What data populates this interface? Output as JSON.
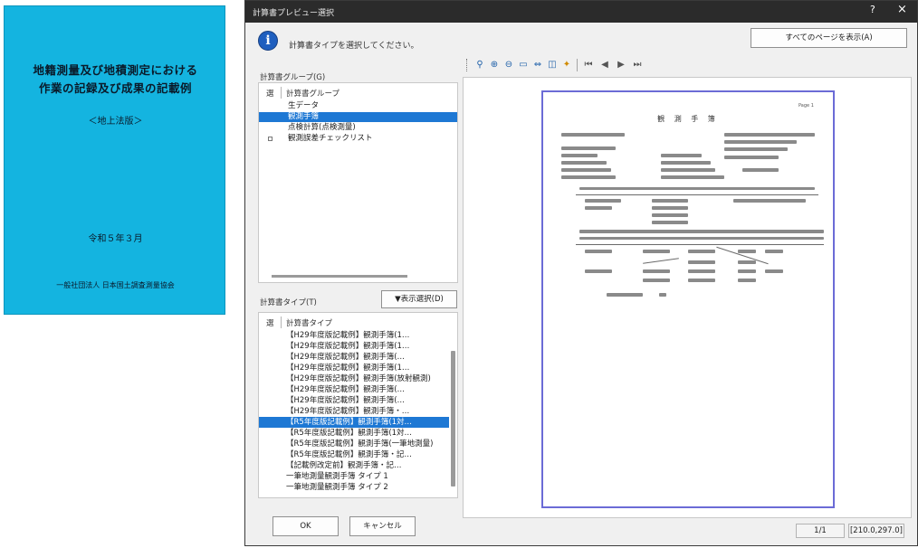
{
  "book": {
    "title_line1": "地籍測量及び地積測定における",
    "title_line2": "作業の記録及び成果の記載例",
    "subtitle": "＜地上法版＞",
    "date": "令和５年３月",
    "publisher": "一般社団法人 日本国土調査測量協会"
  },
  "dialog": {
    "title": "計算書プレビュー選択",
    "help_label": "?",
    "close_label": "×",
    "instruction": "計算書タイプを選択してください。",
    "show_all_pages_label": "すべてのページを表示(A)",
    "group_section_label": "計算書グループ(G)",
    "group_columns": {
      "select": "選",
      "group": "計算書グループ"
    },
    "groups": [
      {
        "label": "生データ",
        "selected": false,
        "checkbox": false
      },
      {
        "label": "観測手簿",
        "selected": true,
        "checkbox": false
      },
      {
        "label": "点検計算(点検測量)",
        "selected": false,
        "checkbox": false
      },
      {
        "label": "観測誤差チェックリスト",
        "selected": false,
        "checkbox": true
      }
    ],
    "type_section_label": "計算書タイプ(T)",
    "filter_button_label": "▼表示選択(D)",
    "type_columns": {
      "select": "選",
      "type": "計算書タイプ"
    },
    "types": [
      {
        "label": "【H29年度版記載例】観測手簿(1…",
        "selected": false
      },
      {
        "label": "【H29年度版記載例】観測手簿(1…",
        "selected": false
      },
      {
        "label": "【H29年度版記載例】観測手簿(…",
        "selected": false
      },
      {
        "label": "【H29年度版記載例】観測手簿(1…",
        "selected": false
      },
      {
        "label": "【H29年度版記載例】観測手簿(放射観測)",
        "selected": false
      },
      {
        "label": "【H29年度版記載例】観測手簿(…",
        "selected": false
      },
      {
        "label": "【H29年度版記載例】観測手簿(…",
        "selected": false
      },
      {
        "label": "【H29年度版記載例】観測手簿・…",
        "selected": false
      },
      {
        "label": "【R5年度版記載例】観測手簿(1対…",
        "selected": true
      },
      {
        "label": "【R5年度版記載例】観測手簿(1対…",
        "selected": false
      },
      {
        "label": "【R5年度版記載例】観測手簿(一筆地測量)",
        "selected": false
      },
      {
        "label": "【R5年度版記載例】観測手簿・記…",
        "selected": false
      },
      {
        "label": "【記載例改定前】観測手簿・記…",
        "selected": false
      },
      {
        "label": "一筆地測量観測手簿 タイプ 1",
        "selected": false
      },
      {
        "label": "一筆地測量観測手簿 タイプ 2",
        "selected": false
      }
    ],
    "ok_label": "OK",
    "cancel_label": "キャンセル",
    "toolbar_icons": [
      "zoom-icon",
      "zoom-in-icon",
      "zoom-out-icon",
      "fit-page-icon",
      "fit-width-icon",
      "two-page-icon",
      "lightbulb-icon",
      "first-page-icon",
      "prev-page-icon",
      "next-page-icon",
      "last-page-icon"
    ],
    "preview": {
      "page_title": "観 測 手 簿",
      "page_number": "Page 1"
    },
    "status": {
      "page": "1/1",
      "paper_size": "[210.0,297.0]"
    }
  }
}
